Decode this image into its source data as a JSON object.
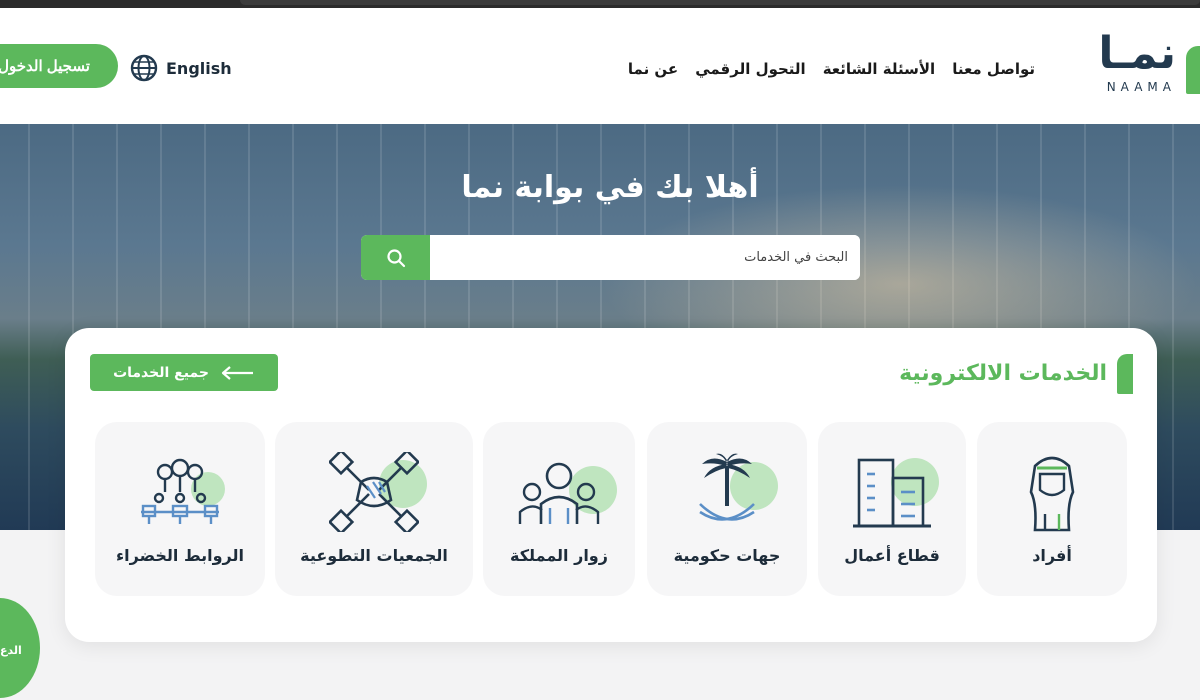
{
  "header": {
    "logo_arabic": "نمـا",
    "logo_latin": "NAAMA",
    "nav": [
      "عن نما",
      "التحول الرقمي",
      "الأسئلة الشائعة",
      "تواصل معنا"
    ],
    "language": "English",
    "login": "تسجيل الدخول"
  },
  "hero": {
    "title": "أهلا بك في بوابة نما",
    "search_placeholder": "البحث في الخدمات"
  },
  "services": {
    "title": "الخدمات الالكترونية",
    "all_services": "جميع الخدمات",
    "items": [
      {
        "label": "أفراد",
        "icon": "individual-icon"
      },
      {
        "label": "قطاع أعمال",
        "icon": "building-icon"
      },
      {
        "label": "جهات حكومية",
        "icon": "palm-swords-icon"
      },
      {
        "label": "زوار المملكة",
        "icon": "visitors-icon"
      },
      {
        "label": "الجمعيات التطوعية",
        "icon": "hands-icon"
      },
      {
        "label": "الروابط الخضراء",
        "icon": "green-links-icon"
      }
    ]
  },
  "help": {
    "label": "الدع"
  },
  "colors": {
    "accent": "#5cb85c",
    "navy": "#233a4f"
  }
}
